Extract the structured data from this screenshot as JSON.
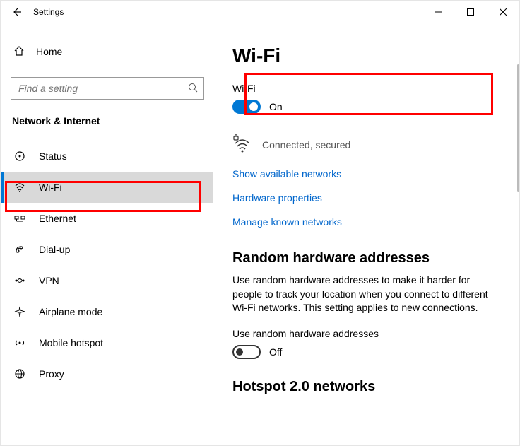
{
  "window": {
    "title": "Settings"
  },
  "sidebar": {
    "home": "Home",
    "search_placeholder": "Find a setting",
    "section": "Network & Internet",
    "items": [
      {
        "label": "Status"
      },
      {
        "label": "Wi-Fi"
      },
      {
        "label": "Ethernet"
      },
      {
        "label": "Dial-up"
      },
      {
        "label": "VPN"
      },
      {
        "label": "Airplane mode"
      },
      {
        "label": "Mobile hotspot"
      },
      {
        "label": "Proxy"
      }
    ]
  },
  "main": {
    "title": "Wi-Fi",
    "wifi_label": "Wi-Fi",
    "wifi_state": "On",
    "conn_status": "Connected, secured",
    "links": {
      "show_networks": "Show available networks",
      "hw_props": "Hardware properties",
      "manage_known": "Manage known networks"
    },
    "random_heading": "Random hardware addresses",
    "random_desc": "Use random hardware addresses to make it harder for people to track your location when you connect to different Wi-Fi networks. This setting applies to new connections.",
    "random_toggle_label": "Use random hardware addresses",
    "random_state": "Off",
    "hotspot_heading": "Hotspot 2.0 networks"
  }
}
